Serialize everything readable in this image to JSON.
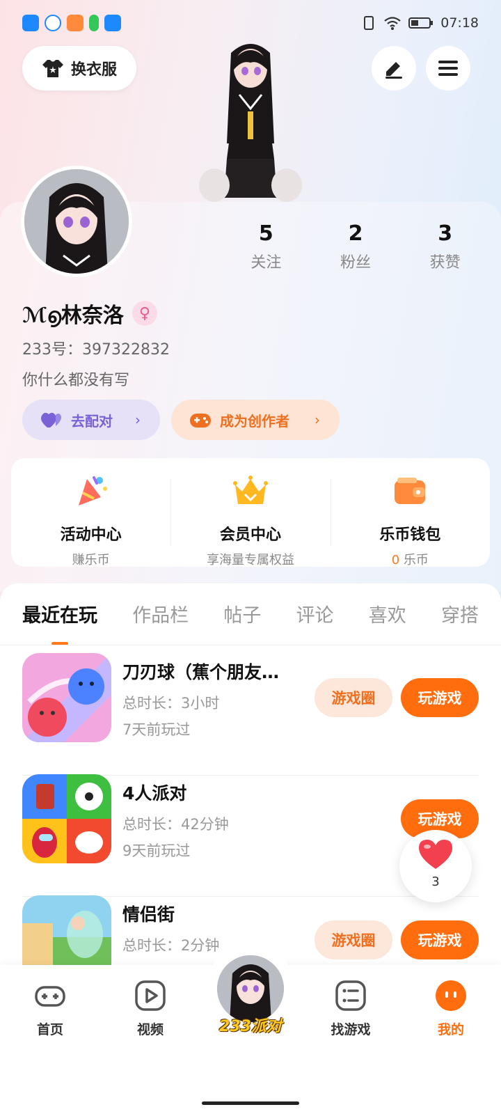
{
  "status_bar": {
    "time": "07:18"
  },
  "header": {
    "outfit_label": "换衣服",
    "edit_icon": "pen-icon",
    "menu_icon": "menu-icon"
  },
  "stats": [
    {
      "count": "5",
      "label": "关注"
    },
    {
      "count": "2",
      "label": "粉丝"
    },
    {
      "count": "3",
      "label": "获赞"
    }
  ],
  "profile": {
    "name": "ℳ൭林奈洛",
    "gender_symbol": "♀",
    "id_text": "233号：397322832",
    "bio": "你什么都没有写"
  },
  "actions": {
    "match_label": "去配对",
    "creator_label": "成为创作者",
    "chevron": "›"
  },
  "features": [
    {
      "title": "活动中心",
      "subtitle": "赚乐币"
    },
    {
      "title": "会员中心",
      "subtitle": "享海量专属权益"
    },
    {
      "title": "乐币钱包",
      "coin_value": "0",
      "subtitle": " 乐币"
    }
  ],
  "tabs": [
    "最近在玩",
    "作品栏",
    "帖子",
    "评论",
    "喜欢",
    "穿搭"
  ],
  "games": [
    {
      "name": "刀刃球（蕉个朋友…",
      "duration": "总时长：3小时",
      "last_played": "7天前玩过",
      "circle_label": "游戏圈",
      "play_label": "玩游戏"
    },
    {
      "name": "4人派对",
      "duration": "总时长：42分钟",
      "last_played": "9天前玩过",
      "circle_label": "",
      "play_label": "玩游戏"
    },
    {
      "name": "情侣街",
      "duration": "总时长：2分钟",
      "last_played": "",
      "circle_label": "游戏圈",
      "play_label": "玩游戏"
    }
  ],
  "like_float": {
    "count": "3"
  },
  "bottom_nav": [
    {
      "label": "首页",
      "icon": "gamepad-icon"
    },
    {
      "label": "视频",
      "icon": "play-icon"
    },
    {
      "label": "233派对",
      "icon": "avatar"
    },
    {
      "label": "找游戏",
      "icon": "list-icon"
    },
    {
      "label": "我的",
      "icon": "profile-icon"
    }
  ],
  "colors": {
    "accent": "#ff6d0e",
    "match_purple": "#7b61d6",
    "gender_pink": "#ee5b93"
  }
}
